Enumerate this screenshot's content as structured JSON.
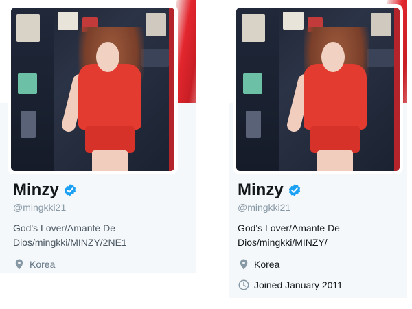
{
  "profiles": [
    {
      "name": "Minzy",
      "handle": "@mingkki21",
      "bio": "God's Lover/Amante De Dios/mingkki/MINZY/2NE1",
      "location": "Korea",
      "location_icon": "map-pin-icon"
    },
    {
      "name": "Minzy",
      "handle": "@mingkki21",
      "bio": "God's Lover/Amante De Dios/mingkki/MINZY/",
      "location": "Korea",
      "location_icon": "map-pin-icon",
      "joined": "Joined January 2011",
      "joined_icon": "clock-icon"
    }
  ],
  "colors": {
    "verified_badge": "#1da1f2",
    "muted_text": "#8899a6",
    "card_background": "#f5f8fa",
    "banner_accent": "#e3262e"
  }
}
